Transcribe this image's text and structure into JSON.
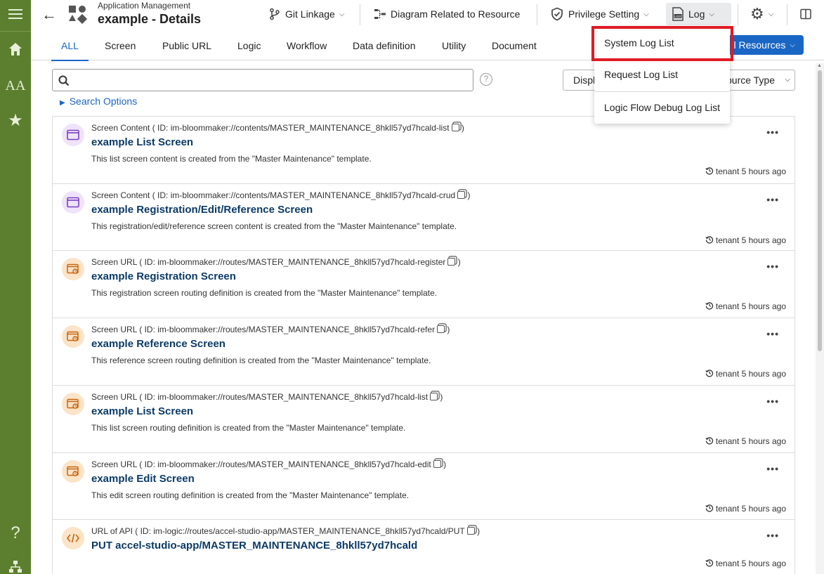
{
  "header": {
    "breadcrumb": "Application Management",
    "title": "example - Details",
    "git_linkage": "Git Linkage",
    "diagram": "Diagram Related to Resource",
    "privilege": "Privilege Setting",
    "log": "Log"
  },
  "tabs": [
    {
      "label": "ALL"
    },
    {
      "label": "Screen"
    },
    {
      "label": "Public URL"
    },
    {
      "label": "Logic"
    },
    {
      "label": "Workflow"
    },
    {
      "label": "Data definition"
    },
    {
      "label": "Utility"
    },
    {
      "label": "Document"
    }
  ],
  "all_resources_label": "l Resources",
  "search": {
    "value": "",
    "placeholder": "",
    "display_label": "Displ",
    "resource_type_label": "ource Type",
    "search_options": "Search Options"
  },
  "log_menu": {
    "items": [
      {
        "label": "System Log List"
      },
      {
        "label": "Request Log List"
      },
      {
        "label": "Logic Flow Debug Log List"
      }
    ]
  },
  "resources": [
    {
      "type": "Screen Content",
      "id": "im-bloommaker://contents/MASTER_MAINTENANCE_8hkll57yd7hcald-list",
      "name": "example List Screen",
      "description": "This list screen content is created from the \"Master Maintenance\" template.",
      "timestamp": "tenant 5 hours ago",
      "icon": "window-icon"
    },
    {
      "type": "Screen Content",
      "id": "im-bloommaker://contents/MASTER_MAINTENANCE_8hkll57yd7hcald-crud",
      "name": "example Registration/Edit/Reference Screen",
      "description": "This registration/edit/reference screen content is created from the \"Master Maintenance\" template.",
      "timestamp": "tenant 5 hours ago",
      "icon": "window-icon"
    },
    {
      "type": "Screen URL",
      "id": "im-bloommaker://routes/MASTER_MAINTENANCE_8hkll57yd7hcald-register",
      "name": "example Registration Screen",
      "description": "This registration screen routing definition is created from the \"Master Maintenance\" template.",
      "timestamp": "tenant 5 hours ago",
      "icon": "route-icon"
    },
    {
      "type": "Screen URL",
      "id": "im-bloommaker://routes/MASTER_MAINTENANCE_8hkll57yd7hcald-refer",
      "name": "example Reference Screen",
      "description": "This reference screen routing definition is created from the \"Master Maintenance\" template.",
      "timestamp": "tenant 5 hours ago",
      "icon": "route-icon"
    },
    {
      "type": "Screen URL",
      "id": "im-bloommaker://routes/MASTER_MAINTENANCE_8hkll57yd7hcald-list",
      "name": "example List Screen",
      "description": "This list screen routing definition is created from the \"Master Maintenance\" template.",
      "timestamp": "tenant 5 hours ago",
      "icon": "route-icon"
    },
    {
      "type": "Screen URL",
      "id": "im-bloommaker://routes/MASTER_MAINTENANCE_8hkll57yd7hcald-edit",
      "name": "example Edit Screen",
      "description": "This edit screen routing definition is created from the \"Master Maintenance\" template.",
      "timestamp": "tenant 5 hours ago",
      "icon": "route-icon"
    },
    {
      "type": "URL of API",
      "id": "im-logic://routes/accel-studio-app/MASTER_MAINTENANCE_8hkll57yd7hcald/PUT",
      "name": "PUT accel-studio-app/MASTER_MAINTENANCE_8hkll57yd7hcald",
      "description": "",
      "timestamp": "tenant 5 hours ago",
      "icon": "code-icon"
    }
  ],
  "colors": {
    "rail": "#5b7f2e",
    "accent": "#1a66c4",
    "highlight": "#e01b24",
    "name_text": "#0b3a66"
  }
}
